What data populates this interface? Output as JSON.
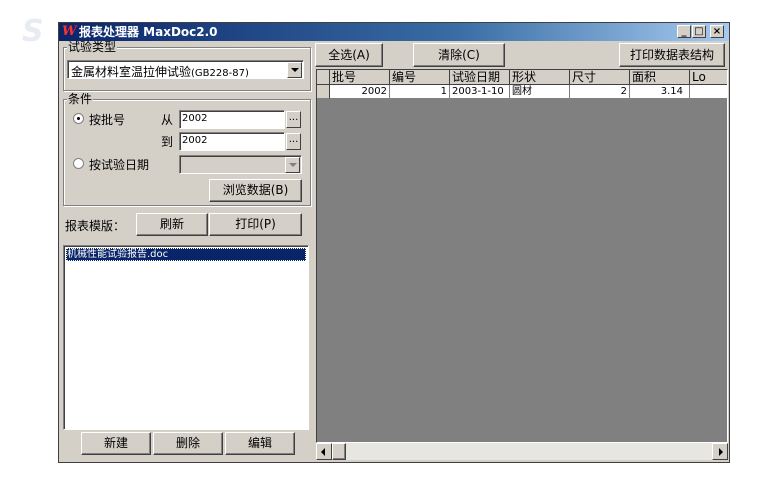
{
  "window": {
    "title": "报表处理器 MaxDoc2.0",
    "icon_glyph": "W",
    "controls": {
      "minimize": "_",
      "maximize": "□",
      "close": "×"
    }
  },
  "test_type": {
    "group_label": "试验类型",
    "selected": "金属材料室温拉伸试验",
    "selected_suffix": "(GB228-87)"
  },
  "conditions": {
    "group_label": "条件",
    "by_batch": {
      "label": "按批号",
      "selected": true,
      "from_label": "从",
      "from_value": "2002",
      "to_label": "到",
      "to_value": "2002",
      "browse_glyph": "..."
    },
    "by_date": {
      "label": "按试验日期",
      "selected": false,
      "value": ""
    },
    "browse_button": "浏览数据(B)"
  },
  "template": {
    "label": "报表模版：",
    "refresh_button": "刷新",
    "print_button": "打印(P)",
    "items": [
      "机械性能试验报告.doc"
    ]
  },
  "bottom_buttons": {
    "new": "新建",
    "delete": "删除",
    "edit": "编辑"
  },
  "toolbar": {
    "select_all": "全选(A)",
    "clear": "清除(C)",
    "print_structure": "打印数据表结构"
  },
  "table": {
    "columns": [
      "批号",
      "编号",
      "试验日期",
      "形状",
      "尺寸",
      "面积",
      "Lo"
    ],
    "rows": [
      [
        "2002",
        "1",
        "2003-1-10",
        "圆材",
        "2",
        "3.14",
        ""
      ]
    ]
  },
  "colors": {
    "titlebar_start": "#0a246a",
    "titlebar_end": "#a6caf0",
    "selection": "#0a246a",
    "grid_bg": "#808080"
  }
}
